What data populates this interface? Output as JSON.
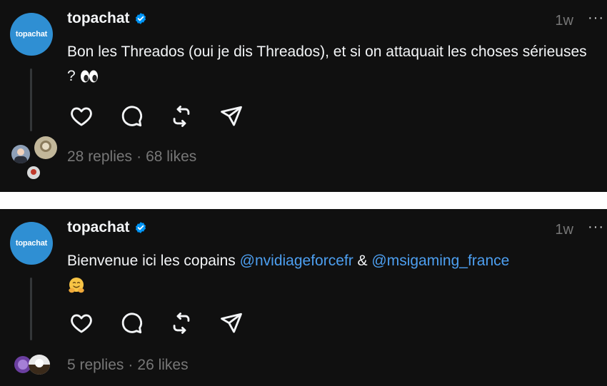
{
  "posts": [
    {
      "avatar_label": "topachat",
      "author": "topachat",
      "time": "1w",
      "more": "···",
      "text_plain": "Bon les Threados (oui je dis Threados), et si on attaquait les choses sérieuses ?",
      "emoji": "eyes",
      "replies": "28 replies",
      "likes": "68 likes",
      "separator": "·"
    },
    {
      "avatar_label": "topachat",
      "author": "topachat",
      "time": "1w",
      "more": "···",
      "text_before": "Bienvenue ici les copains ",
      "mention_1": "@nvidiageforcefr",
      "between": " & ",
      "mention_2": "@msigaming_france",
      "emoji": "hugging-face",
      "replies": "5 replies",
      "likes": "26 likes",
      "separator": "·"
    }
  ],
  "colors": {
    "background": "#101010",
    "avatar": "#2f8fd3",
    "mention": "#4d9ff0",
    "muted": "#777777",
    "verified": "#0095f6"
  },
  "icons": [
    "heart-icon",
    "comment-icon",
    "repost-icon",
    "share-icon",
    "verified-badge-icon",
    "more-icon"
  ]
}
